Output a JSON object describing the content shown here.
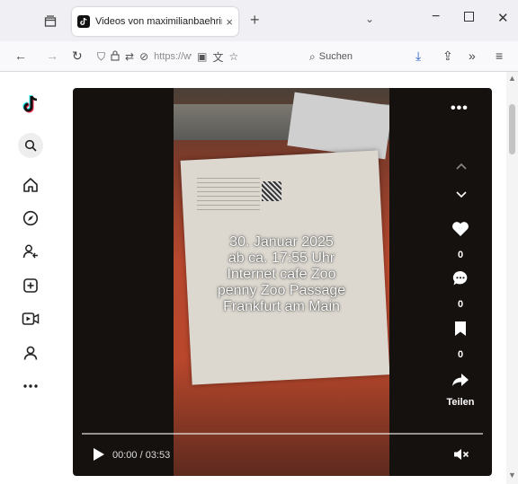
{
  "browser": {
    "tab_title": "Videos von maximilianbaehring",
    "tab_close": "×",
    "new_tab": "+",
    "tab_list": "⌄",
    "url_text": "https://ww",
    "search_placeholder": "Suchen",
    "window": {
      "minimize": "−",
      "close": "✕"
    }
  },
  "sidebar": {
    "items": [
      {
        "name": "tiktok-logo"
      },
      {
        "name": "search"
      },
      {
        "name": "home"
      },
      {
        "name": "explore"
      },
      {
        "name": "following"
      },
      {
        "name": "upload"
      },
      {
        "name": "live"
      },
      {
        "name": "profile"
      },
      {
        "name": "more"
      }
    ]
  },
  "video": {
    "caption_lines": [
      "30. Januar 2025",
      "ab ca. 17:55 Uhr",
      "Internet cafe Zoo",
      "penny Zoo Passage",
      "Frankfurt am Main"
    ],
    "more": "•••",
    "likes": "0",
    "comments": "0",
    "saves": "0",
    "share_label": "Teilen",
    "time": "00:00 / 03:53",
    "progress": 0
  },
  "colors": {
    "tab_bar": "#f0f0f4",
    "toolbar": "#f9f9fb",
    "video_bg": "#15110f",
    "caption": "#ffffff"
  }
}
